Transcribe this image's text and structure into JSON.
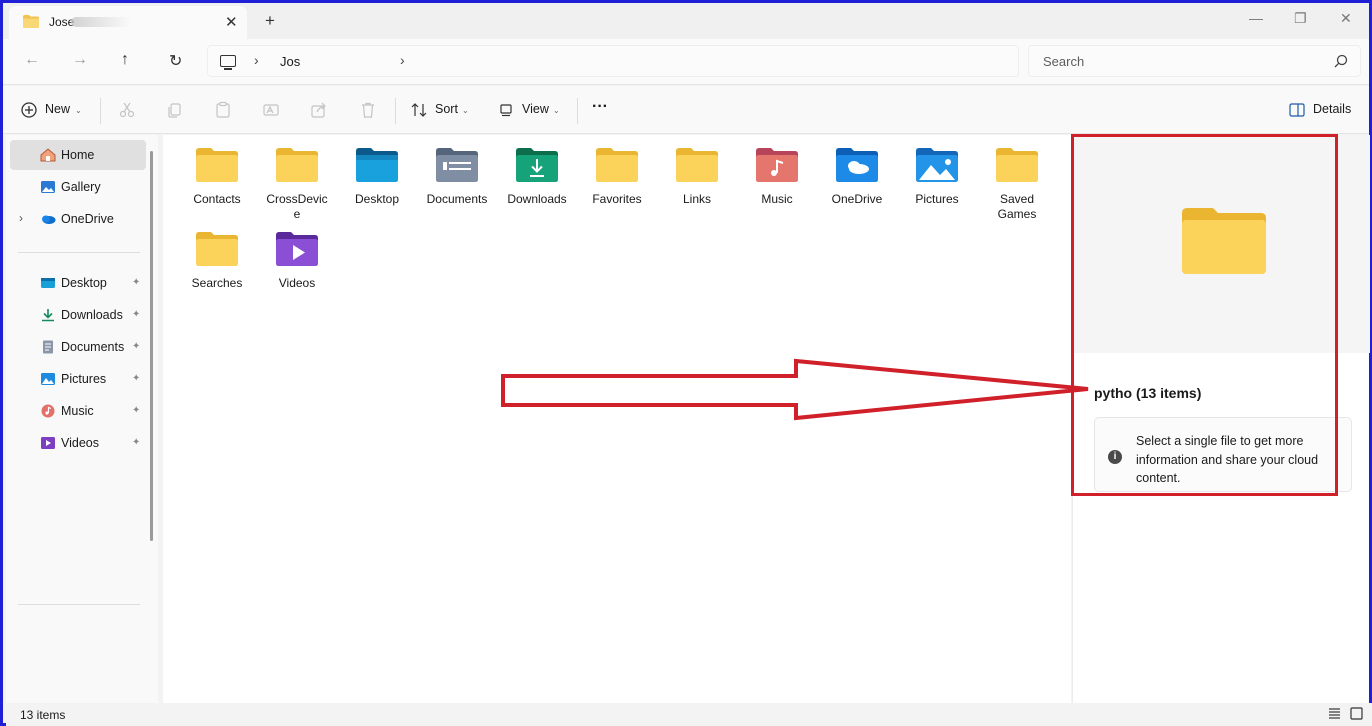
{
  "window": {
    "tab_title": "Jose",
    "close_tab": "✕",
    "new_tab": "+",
    "minimize": "—",
    "maximize": "❐",
    "close": "✕"
  },
  "nav": {
    "back": "←",
    "forward": "→",
    "up": "↑",
    "refresh": "↻",
    "breadcrumb_sep": "›",
    "breadcrumb": "Jos",
    "search_placeholder": "Search"
  },
  "toolbar": {
    "new_label": "New",
    "sort_label": "Sort",
    "view_label": "View",
    "more_label": "···",
    "details_label": "Details"
  },
  "sidebar": {
    "top": [
      {
        "label": "Home",
        "icon": "home-icon",
        "selected": true
      },
      {
        "label": "Gallery",
        "icon": "gallery-icon"
      },
      {
        "label": "OneDrive",
        "icon": "onedrive-icon",
        "expandable": true
      }
    ],
    "pinned": [
      {
        "label": "Desktop",
        "icon": "desktop-icon"
      },
      {
        "label": "Downloads",
        "icon": "downloads-icon"
      },
      {
        "label": "Documents",
        "icon": "documents-icon"
      },
      {
        "label": "Pictures",
        "icon": "pictures-icon"
      },
      {
        "label": "Music",
        "icon": "music-icon"
      },
      {
        "label": "Videos",
        "icon": "videos-icon"
      }
    ],
    "pin_glyph": "📌",
    "chevron": "›"
  },
  "folders": [
    {
      "name": "Contacts",
      "icon": "folder-icon"
    },
    {
      "name": "CrossDevic e",
      "icon": "folder-icon"
    },
    {
      "name": "Desktop",
      "icon": "desktop-folder-icon"
    },
    {
      "name": "Documents",
      "icon": "documents-folder-icon"
    },
    {
      "name": "Downloads",
      "icon": "downloads-folder-icon"
    },
    {
      "name": "Favorites",
      "icon": "folder-icon"
    },
    {
      "name": "Links",
      "icon": "folder-icon"
    },
    {
      "name": "Music",
      "icon": "music-folder-icon"
    },
    {
      "name": "OneDrive",
      "icon": "onedrive-folder-icon"
    },
    {
      "name": "Pictures",
      "icon": "pictures-folder-icon"
    },
    {
      "name": "Saved Games",
      "icon": "folder-icon"
    },
    {
      "name": "Searches",
      "icon": "folder-icon"
    },
    {
      "name": "Videos",
      "icon": "videos-folder-icon"
    }
  ],
  "details": {
    "title": "pytho (13 items)",
    "info_icon": "i",
    "info_text": "Select a single file to get more information and share your cloud content."
  },
  "status": {
    "item_count": "13 items"
  },
  "colors": {
    "annotation_red": "#d0202a",
    "window_border": "#1f1fd6",
    "folder_yellow": "#f8cd55"
  }
}
